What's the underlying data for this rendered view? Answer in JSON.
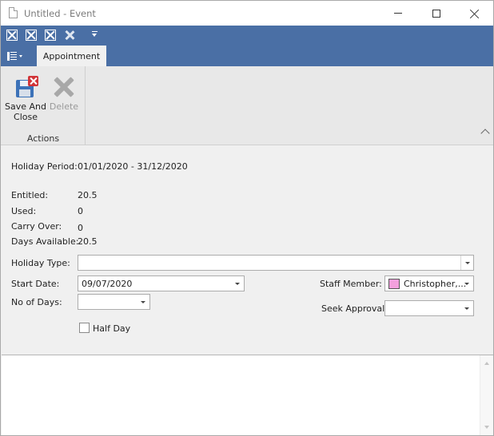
{
  "window": {
    "title": "Untitled - Event",
    "minimize_icon": "minimize-icon",
    "maximize_icon": "maximize-icon",
    "close_icon": "close-icon"
  },
  "quick_access": {
    "icons": [
      "close-box-icon",
      "close-box-icon",
      "close-box-icon",
      "delete-icon",
      "dropdown-icon"
    ]
  },
  "ribbon": {
    "tabs": [
      {
        "label": "Appointment",
        "active": true
      }
    ],
    "groups": [
      {
        "label": "Actions",
        "buttons": [
          {
            "label_line1": "Save And",
            "label_line2": "Close",
            "icon": "save-close-icon",
            "enabled": true
          },
          {
            "label": "Delete",
            "icon": "delete-icon",
            "enabled": false
          }
        ]
      }
    ]
  },
  "form": {
    "holiday_period": {
      "label": "Holiday Period:",
      "value": "01/01/2020 - 31/12/2020"
    },
    "entitled": {
      "label": "Entitled:",
      "value": "20.5"
    },
    "used": {
      "label": "Used:",
      "value": "0"
    },
    "carry_over": {
      "label": "Carry Over:",
      "value": "0"
    },
    "days_available": {
      "label": "Days Available:",
      "value": "20.5"
    },
    "holiday_type": {
      "label": "Holiday Type:",
      "value": ""
    },
    "start_date": {
      "label": "Start Date:",
      "value": "09/07/2020"
    },
    "no_of_days": {
      "label": "No of Days:",
      "value": ""
    },
    "half_day": {
      "label": "Half Day",
      "checked": false
    },
    "staff_member": {
      "label": "Staff Member:",
      "value": "Christopher,...",
      "color": "#f3a0dd"
    },
    "seek_approval": {
      "label": "Seek Approval:",
      "value": ""
    }
  },
  "colors": {
    "accent": "#4a6fa5",
    "ribbon_bg": "#e8e8e8",
    "form_bg": "#f0f0f0"
  }
}
